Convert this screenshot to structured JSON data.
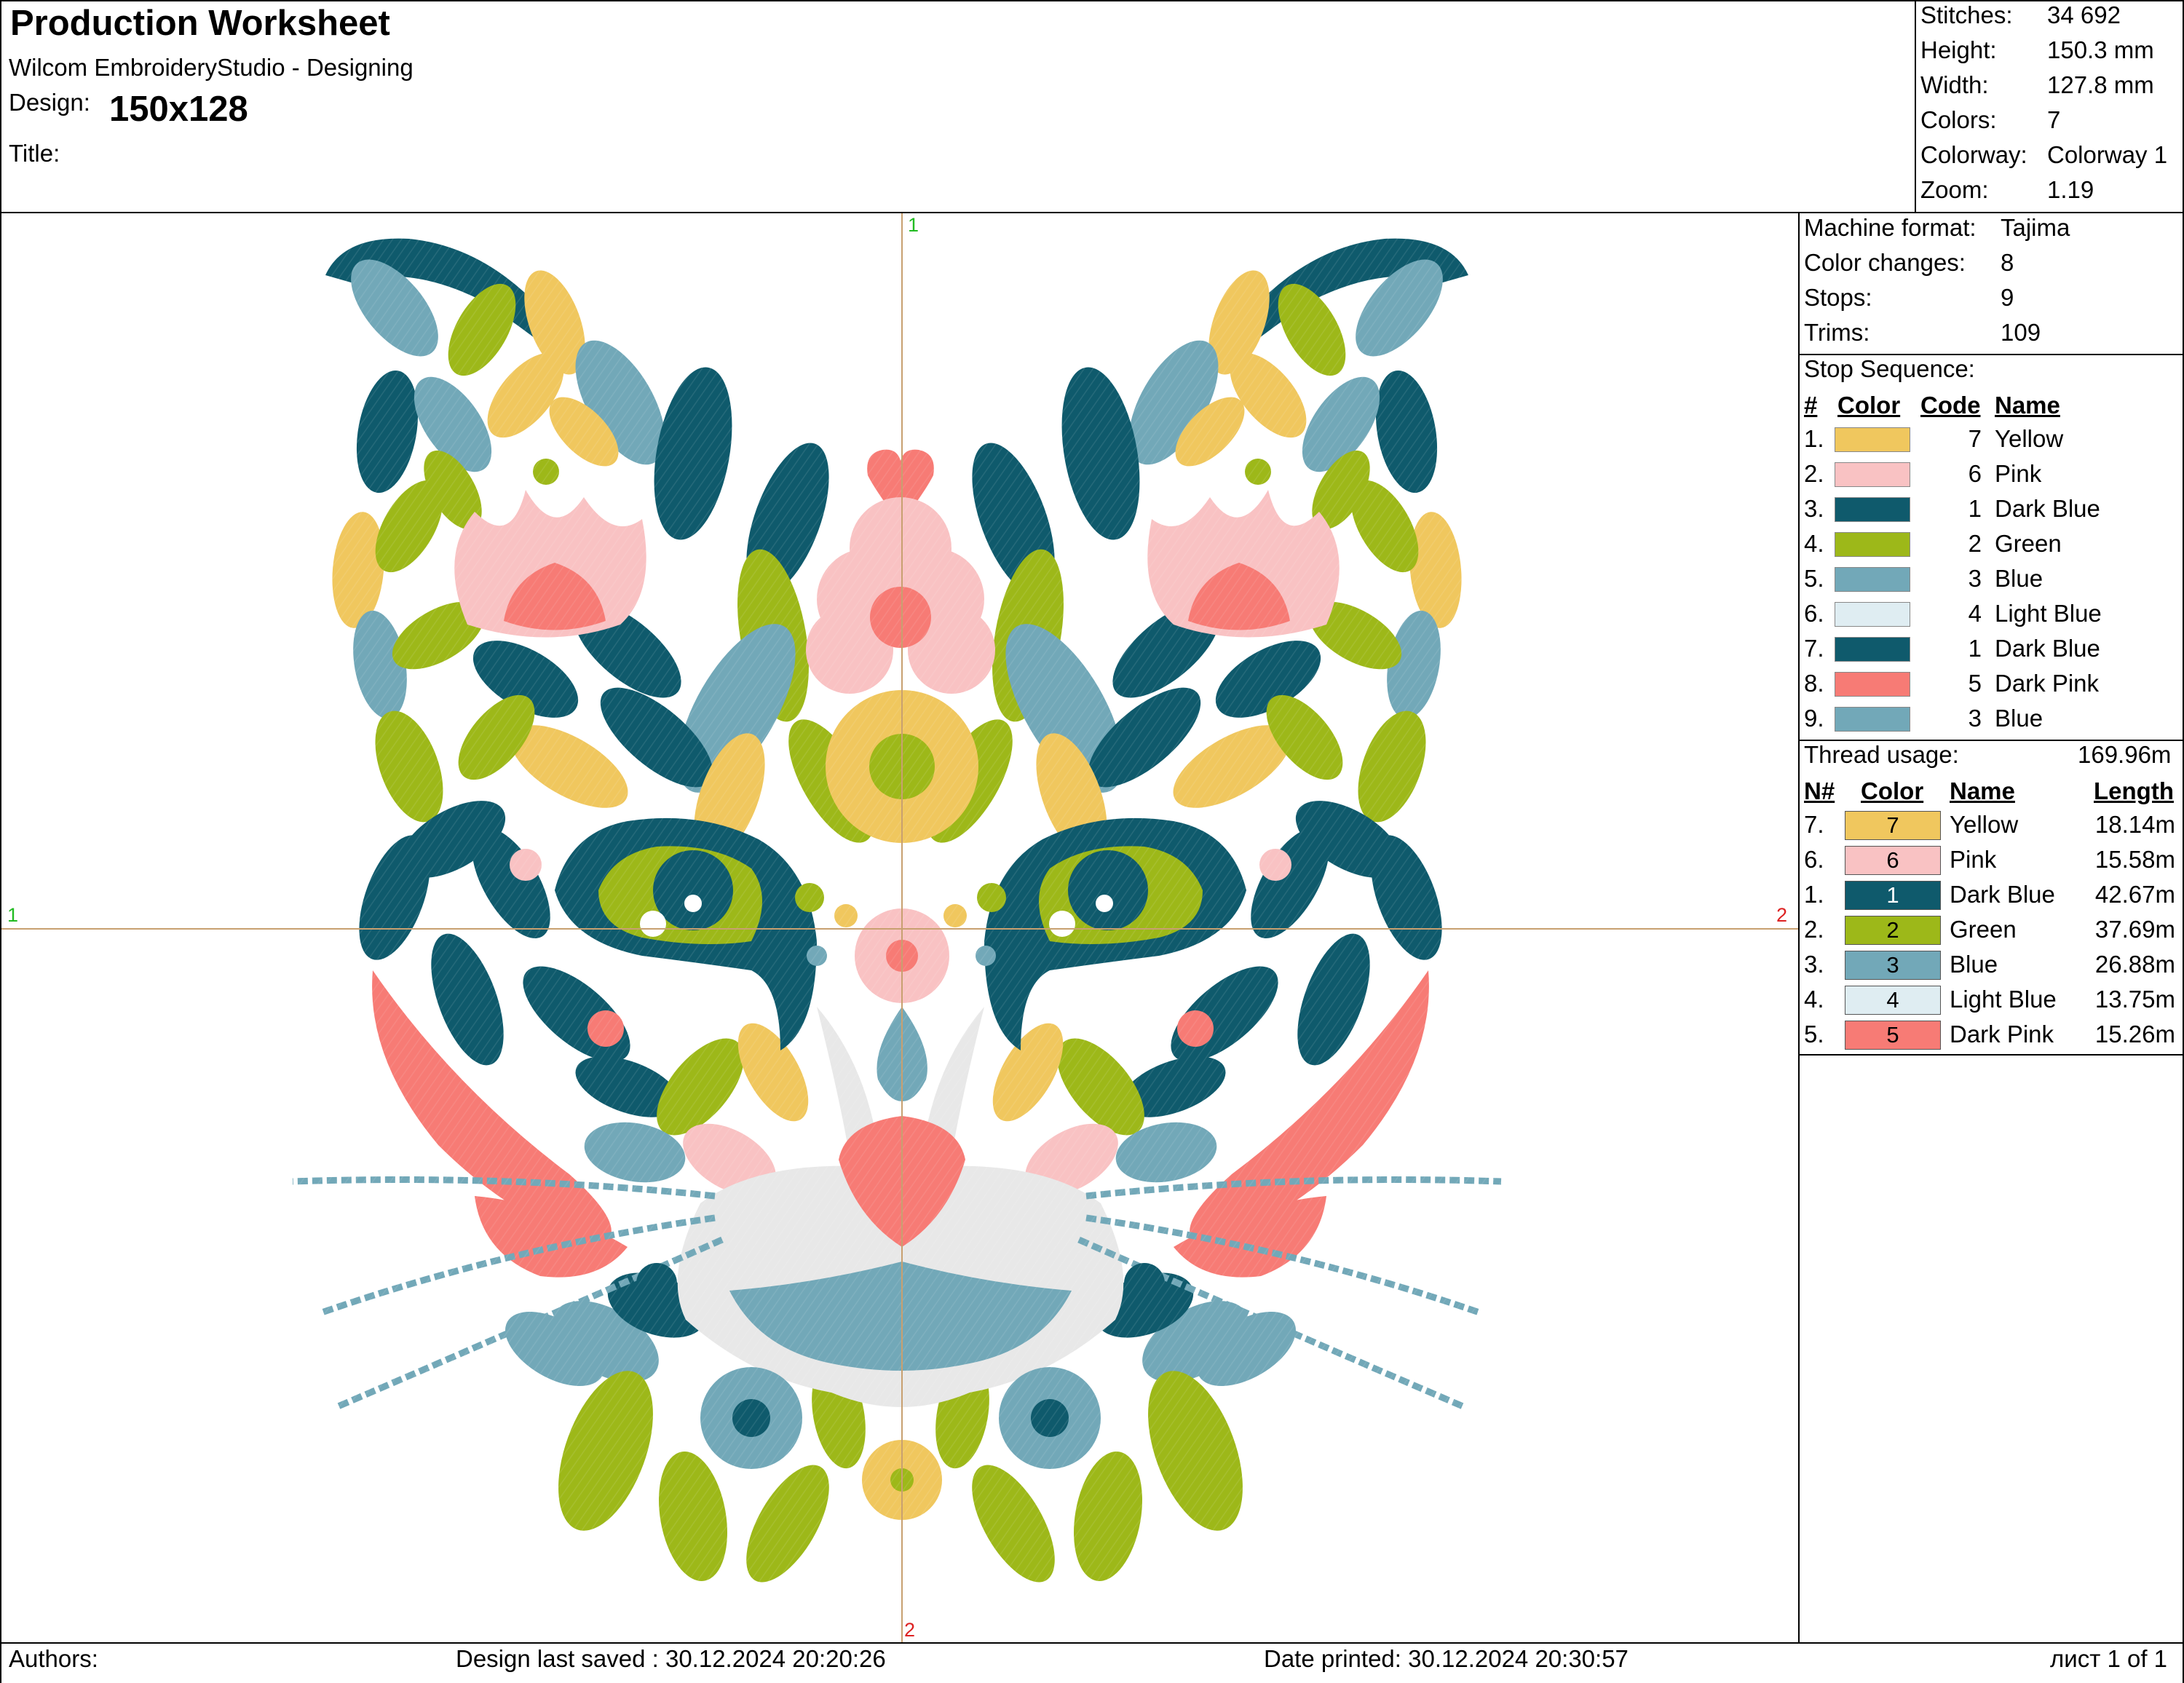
{
  "header": {
    "title": "Production Worksheet",
    "app": "Wilcom EmbroideryStudio - Designing",
    "design_label": "Design:",
    "design_value": "150x128",
    "title_label": "Title:"
  },
  "summary": [
    {
      "label": "Stitches:",
      "value": "34 692"
    },
    {
      "label": "Height:",
      "value": "150.3 mm"
    },
    {
      "label": "Width:",
      "value": "127.8 mm"
    },
    {
      "label": "Colors:",
      "value": "7"
    },
    {
      "label": "Colorway:",
      "value": "Colorway 1"
    },
    {
      "label": "Zoom:",
      "value": "1.19"
    }
  ],
  "machine": [
    {
      "label": "Machine format:",
      "value": "Tajima"
    },
    {
      "label": "Color changes:",
      "value": "8"
    },
    {
      "label": "Stops:",
      "value": "9"
    },
    {
      "label": "Trims:",
      "value": "109"
    }
  ],
  "stop_sequence": {
    "title": "Stop Sequence:",
    "headers": {
      "num": "#",
      "color": "Color",
      "code": "Code",
      "name": "Name"
    },
    "rows": [
      {
        "num": "1.",
        "hex": "#f0c75e",
        "code": "7",
        "name": "Yellow"
      },
      {
        "num": "2.",
        "hex": "#f9c2c3",
        "code": "6",
        "name": "Pink"
      },
      {
        "num": "3.",
        "hex": "#0f5a6c",
        "code": "1",
        "name": "Dark Blue"
      },
      {
        "num": "4.",
        "hex": "#9db819",
        "code": "2",
        "name": "Green"
      },
      {
        "num": "5.",
        "hex": "#72a8b8",
        "code": "3",
        "name": "Blue"
      },
      {
        "num": "6.",
        "hex": "#dfedf2",
        "code": "4",
        "name": "Light Blue"
      },
      {
        "num": "7.",
        "hex": "#0f5a6c",
        "code": "1",
        "name": "Dark Blue"
      },
      {
        "num": "8.",
        "hex": "#f77b75",
        "code": "5",
        "name": "Dark Pink"
      },
      {
        "num": "9.",
        "hex": "#72a8b8",
        "code": "3",
        "name": "Blue"
      }
    ]
  },
  "thread_usage": {
    "title": "Thread usage:",
    "total": "169.96m",
    "headers": {
      "num": "N#",
      "color": "Color",
      "name": "Name",
      "length": "Length"
    },
    "rows": [
      {
        "num": "7.",
        "hex": "#f0c75e",
        "code": "7",
        "name": "Yellow",
        "length": "18.14m",
        "text_color": "#000000"
      },
      {
        "num": "6.",
        "hex": "#f9c2c3",
        "code": "6",
        "name": "Pink",
        "length": "15.58m",
        "text_color": "#000000"
      },
      {
        "num": "1.",
        "hex": "#0f5a6c",
        "code": "1",
        "name": "Dark Blue",
        "length": "42.67m",
        "text_color": "#ffffff"
      },
      {
        "num": "2.",
        "hex": "#9db819",
        "code": "2",
        "name": "Green",
        "length": "37.69m",
        "text_color": "#000000"
      },
      {
        "num": "3.",
        "hex": "#72a8b8",
        "code": "3",
        "name": "Blue",
        "length": "26.88m",
        "text_color": "#000000"
      },
      {
        "num": "4.",
        "hex": "#dfedf2",
        "code": "4",
        "name": "Light Blue",
        "length": "13.75m",
        "text_color": "#000000"
      },
      {
        "num": "5.",
        "hex": "#f77b75",
        "code": "5",
        "name": "Dark Pink",
        "length": "15.26m",
        "text_color": "#000000"
      }
    ]
  },
  "markers": {
    "top": "1",
    "bottom": "2",
    "left": "1",
    "right": "2"
  },
  "footer": {
    "authors": "Authors:",
    "saved": "Design last saved : 30.12.2024 20:20:26",
    "printed": "Date printed: 30.12.2024 20:30:57",
    "page": "лист 1 of 1"
  },
  "palette": {
    "dark_blue": "#0f5a6c",
    "blue": "#72a8b8",
    "light_blue": "#dfedf2",
    "green": "#9db819",
    "yellow": "#f0c75e",
    "pink": "#f9c2c3",
    "dark_pink": "#f77b75",
    "white_thread": "#e8e8e8",
    "guide_line": "#c8a070"
  }
}
